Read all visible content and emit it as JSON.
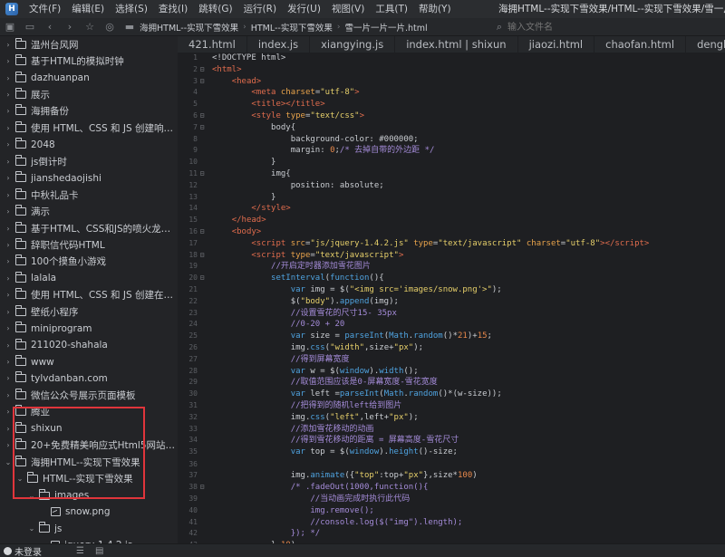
{
  "menubar": {
    "items": [
      "文件(F)",
      "编辑(E)",
      "选择(S)",
      "查找(I)",
      "跳转(G)",
      "运行(R)",
      "发行(U)",
      "视图(V)",
      "工具(T)",
      "帮助(Y)"
    ],
    "window_title": "海拥HTML--实现下雪效果/HTML--实现下雪效果/雪一片一片..."
  },
  "toolbar": {
    "breadcrumb": [
      "海拥HTML--实现下雪效果",
      "HTML--实现下雪效果",
      "雪一片一片一片.html"
    ],
    "file_search_placeholder": "输入文件名"
  },
  "tabs": [
    "421.html",
    "index.js",
    "xiangying.js",
    "index.html | shixun",
    "jiaozi.html",
    "chaofan.html",
    "denglu.htm"
  ],
  "sidebar": {
    "items": [
      {
        "label": "温州台风网",
        "kind": "folder",
        "depth": 0,
        "arrow": "›"
      },
      {
        "label": "基于HTML的模拟时钟",
        "kind": "folder",
        "depth": 0,
        "arrow": "›"
      },
      {
        "label": "dazhuanpan",
        "kind": "folder",
        "depth": 0,
        "arrow": "›"
      },
      {
        "label": "展示",
        "kind": "folder",
        "depth": 0,
        "arrow": "›"
      },
      {
        "label": "海拥备份",
        "kind": "folder",
        "depth": 0,
        "arrow": "›"
      },
      {
        "label": "使用 HTML、CSS 和 JS 创建响应式可...",
        "kind": "folder",
        "depth": 0,
        "arrow": "›"
      },
      {
        "label": "2048",
        "kind": "folder",
        "depth": 0,
        "arrow": "›"
      },
      {
        "label": "js倒计时",
        "kind": "folder",
        "depth": 0,
        "arrow": "›"
      },
      {
        "label": "jianshedaojishi",
        "kind": "folder",
        "depth": 0,
        "arrow": "›"
      },
      {
        "label": "中秋礼品卡",
        "kind": "folder",
        "depth": 0,
        "arrow": "›"
      },
      {
        "label": "满示",
        "kind": "folder",
        "depth": 0,
        "arrow": "›"
      },
      {
        "label": "基于HTML、CSS和JS的喷火龙小游戏",
        "kind": "folder",
        "depth": 0,
        "arrow": "›"
      },
      {
        "label": "辞职信代码HTML",
        "kind": "folder",
        "depth": 0,
        "arrow": "›"
      },
      {
        "label": "100个摸鱼小游戏",
        "kind": "folder",
        "depth": 0,
        "arrow": "›"
      },
      {
        "label": "lalala",
        "kind": "folder",
        "depth": 0,
        "arrow": "›"
      },
      {
        "label": "使用 HTML、CSS 和 JS 创建在线音乐...",
        "kind": "folder",
        "depth": 0,
        "arrow": "›"
      },
      {
        "label": "壁纸小程序",
        "kind": "folder",
        "depth": 0,
        "arrow": "›"
      },
      {
        "label": "miniprogram",
        "kind": "folder",
        "depth": 0,
        "arrow": "›"
      },
      {
        "label": "211020-shahala",
        "kind": "folder",
        "depth": 0,
        "arrow": "›"
      },
      {
        "label": "www",
        "kind": "folder",
        "depth": 0,
        "arrow": "›"
      },
      {
        "label": "tylvdanban.com",
        "kind": "folder",
        "depth": 0,
        "arrow": "›"
      },
      {
        "label": "微信公众号展示页面模板",
        "kind": "folder",
        "depth": 0,
        "arrow": "›"
      },
      {
        "label": "腾亚",
        "kind": "folder",
        "depth": 0,
        "arrow": "›"
      },
      {
        "label": "shixun",
        "kind": "folder",
        "depth": 0,
        "arrow": "›"
      },
      {
        "label": "20+免费精美响应式Html5网站模板01",
        "kind": "folder",
        "depth": 0,
        "arrow": "›"
      },
      {
        "label": "海拥HTML--实现下雪效果",
        "kind": "folder",
        "depth": 0,
        "arrow": "⌄"
      },
      {
        "label": "HTML--实现下雪效果",
        "kind": "folder",
        "depth": 1,
        "arrow": "⌄"
      },
      {
        "label": "images",
        "kind": "folder",
        "depth": 2,
        "arrow": "⌄"
      },
      {
        "label": "snow.png",
        "kind": "image",
        "depth": 3,
        "arrow": ""
      },
      {
        "label": "js",
        "kind": "folder",
        "depth": 2,
        "arrow": "⌄"
      },
      {
        "label": "jquery-1.4.2.js",
        "kind": "file",
        "depth": 3,
        "arrow": ""
      },
      {
        "label": "雪一片一片一片.html",
        "kind": "code",
        "depth": 2,
        "arrow": "",
        "selected": true
      }
    ]
  },
  "statusbar": {
    "user_label": "未登录"
  },
  "editor": {
    "lines": [
      {
        "n": "1",
        "fold": "",
        "html": "<span class='p'>&lt;!DOCTYPE html&gt;</span>"
      },
      {
        "n": "2",
        "fold": "⊟",
        "html": "<span class='t'>&lt;html&gt;</span>"
      },
      {
        "n": "3",
        "fold": "⊟",
        "html": "    <span class='t'>&lt;head&gt;</span>"
      },
      {
        "n": "4",
        "fold": "",
        "html": "        <span class='t'>&lt;meta</span> <span class='a'>charset</span>=<span class='s'>\"utf-8\"</span><span class='t'>&gt;</span>"
      },
      {
        "n": "5",
        "fold": "",
        "html": "        <span class='t'>&lt;title&gt;&lt;/title&gt;</span>"
      },
      {
        "n": "6",
        "fold": "⊟",
        "html": "        <span class='t'>&lt;style</span> <span class='a'>type</span>=<span class='s'>\"text/css\"</span><span class='t'>&gt;</span>"
      },
      {
        "n": "7",
        "fold": "⊟",
        "html": "            <span class='p'>body{</span>"
      },
      {
        "n": "8",
        "fold": "",
        "html": "                <span class='prop'>background-color: #000000;</span>"
      },
      {
        "n": "9",
        "fold": "",
        "html": "                <span class='prop'>margin: </span><span class='v'>0</span><span class='prop'>;</span><span class='c'>/* 去掉自带的外边距 */</span>"
      },
      {
        "n": "10",
        "fold": "",
        "html": "            <span class='p'>}</span>"
      },
      {
        "n": "11",
        "fold": "⊟",
        "html": "            <span class='p'>img{</span>"
      },
      {
        "n": "12",
        "fold": "",
        "html": "                <span class='prop'>position: absolute;</span>"
      },
      {
        "n": "13",
        "fold": "",
        "html": "            <span class='p'>}</span>"
      },
      {
        "n": "14",
        "fold": "",
        "html": "        <span class='t'>&lt;/style&gt;</span>"
      },
      {
        "n": "15",
        "fold": "",
        "html": "    <span class='t'>&lt;/head&gt;</span>"
      },
      {
        "n": "16",
        "fold": "⊟",
        "html": "    <span class='t'>&lt;body&gt;</span>"
      },
      {
        "n": "17",
        "fold": "",
        "html": "        <span class='t'>&lt;script</span> <span class='a'>src</span>=<span class='s'>\"js/jquery-1.4.2.js\"</span> <span class='a'>type</span>=<span class='s'>\"text/javascript\"</span> <span class='a'>charset</span>=<span class='s'>\"utf-8\"</span><span class='t'>&gt;&lt;/script&gt;</span>"
      },
      {
        "n": "18",
        "fold": "⊟",
        "html": "        <span class='t'>&lt;script</span> <span class='a'>type</span>=<span class='s'>\"text/javascript\"</span><span class='t'>&gt;</span>"
      },
      {
        "n": "19",
        "fold": "",
        "html": "            <span class='c'>//开启定时器添加雪花图片</span>"
      },
      {
        "n": "20",
        "fold": "⊟",
        "html": "            <span class='k'>setInterval</span><span class='p'>(</span><span class='k'>function</span><span class='p'>(){</span>"
      },
      {
        "n": "21",
        "fold": "",
        "html": "                <span class='k'>var</span> <span class='p'>img = $(</span><span class='s'>\"&lt;img src='images/snow.png'&gt;\"</span><span class='p'>);</span>"
      },
      {
        "n": "22",
        "fold": "",
        "html": "                <span class='p'>$(</span><span class='s'>\"body\"</span><span class='p'>).</span><span class='k'>append</span><span class='p'>(img);</span>"
      },
      {
        "n": "23",
        "fold": "",
        "html": "                <span class='c'>//设置雪花的尺寸15- 35px</span>"
      },
      {
        "n": "24",
        "fold": "",
        "html": "                <span class='c'>//0-20 + 20</span>"
      },
      {
        "n": "25",
        "fold": "",
        "html": "                <span class='k'>var</span> <span class='p'>size = </span><span class='k'>parseInt</span><span class='p'>(</span><span class='k'>Math</span><span class='p'>.</span><span class='k'>random</span><span class='p'>()*</span><span class='v'>21</span><span class='p'>)+</span><span class='v'>15</span><span class='p'>;</span>"
      },
      {
        "n": "26",
        "fold": "",
        "html": "                <span class='p'>img.</span><span class='k'>css</span><span class='p'>(</span><span class='s'>\"width\"</span><span class='p'>,size+</span><span class='s'>\"px\"</span><span class='p'>);</span>"
      },
      {
        "n": "27",
        "fold": "",
        "html": "                <span class='c'>//得到屏幕宽度</span>"
      },
      {
        "n": "28",
        "fold": "",
        "html": "                <span class='k'>var</span> <span class='p'>w = $(</span><span class='k'>window</span><span class='p'>).</span><span class='k'>width</span><span class='p'>();</span>"
      },
      {
        "n": "29",
        "fold": "",
        "html": "                <span class='c'>//取值范围应该是0-屏幕宽度-雪花宽度</span>"
      },
      {
        "n": "30",
        "fold": "",
        "html": "                <span class='k'>var</span> <span class='p'>left =</span><span class='k'>parseInt</span><span class='p'>(</span><span class='k'>Math</span><span class='p'>.</span><span class='k'>random</span><span class='p'>()*(w-size));</span>"
      },
      {
        "n": "31",
        "fold": "",
        "html": "                <span class='c'>//把得到的随机left给到图片</span>"
      },
      {
        "n": "32",
        "fold": "",
        "html": "                <span class='p'>img.</span><span class='k'>css</span><span class='p'>(</span><span class='s'>\"left\"</span><span class='p'>,left+</span><span class='s'>\"px\"</span><span class='p'>);</span>"
      },
      {
        "n": "33",
        "fold": "",
        "html": "                <span class='c'>//添加雪花移动的动画</span>"
      },
      {
        "n": "34",
        "fold": "",
        "html": "                <span class='c'>//得到雪花移动的距离 = 屏幕高度-雪花尺寸</span>"
      },
      {
        "n": "35",
        "fold": "",
        "html": "                <span class='k'>var</span> <span class='p'>top = $(</span><span class='k'>window</span><span class='p'>).</span><span class='k'>height</span><span class='p'>()-size;</span>"
      },
      {
        "n": "36",
        "fold": "",
        "html": ""
      },
      {
        "n": "37",
        "fold": "",
        "html": "                <span class='p'>img.</span><span class='k'>animate</span><span class='p'>({</span><span class='s'>\"top\"</span><span class='p'>:top+</span><span class='s'>\"px\"</span><span class='p'>},size*</span><span class='v'>100</span><span class='p'>)</span>"
      },
      {
        "n": "38",
        "fold": "⊟",
        "html": "                <span class='c'>/* .fadeOut(1000,function(){</span>"
      },
      {
        "n": "39",
        "fold": "",
        "html": "                    <span class='c'>//当动画完成时执行此代码</span>"
      },
      {
        "n": "40",
        "fold": "",
        "html": "                    <span class='c'>img.remove();</span>"
      },
      {
        "n": "41",
        "fold": "",
        "html": "                    <span class='c'>//console.log($(\"img\").length);</span>"
      },
      {
        "n": "42",
        "fold": "",
        "html": "                <span class='c'>}); */</span>"
      },
      {
        "n": "43",
        "fold": "",
        "html": "            <span class='p'>},</span><span class='v'>10</span><span class='p'>)</span>"
      }
    ]
  }
}
